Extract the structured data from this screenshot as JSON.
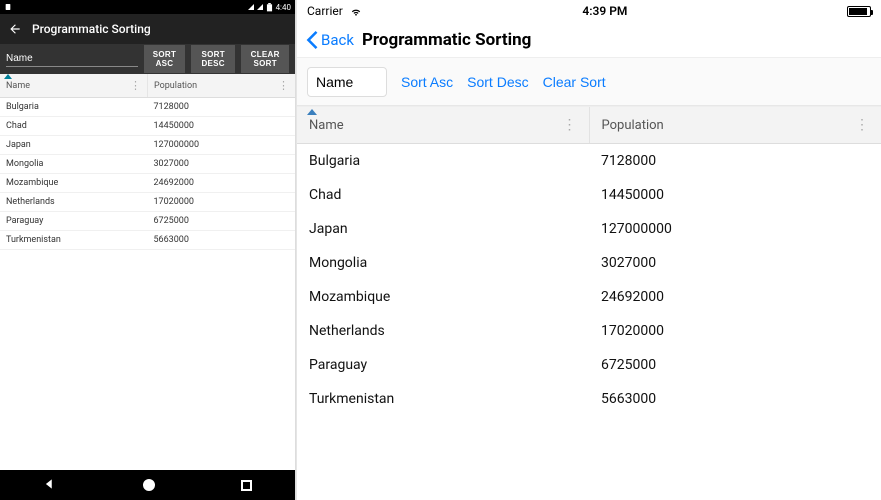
{
  "android": {
    "status_time": "4:40",
    "appbar_title": "Programmatic Sorting",
    "field_value": "Name",
    "buttons": {
      "sort_asc": "SORT ASC",
      "sort_desc": "SORT DESC",
      "clear_sort": "CLEAR SORT"
    },
    "columns": {
      "name": "Name",
      "population": "Population"
    }
  },
  "ios": {
    "status_carrier": "Carrier",
    "status_time": "4:39 PM",
    "nav_back": "Back",
    "nav_title": "Programmatic Sorting",
    "field_value": "Name",
    "buttons": {
      "sort_asc": "Sort Asc",
      "sort_desc": "Sort Desc",
      "clear_sort": "Clear Sort"
    },
    "columns": {
      "name": "Name",
      "population": "Population"
    }
  },
  "rows": [
    {
      "name": "Bulgaria",
      "population": "7128000"
    },
    {
      "name": "Chad",
      "population": "14450000"
    },
    {
      "name": "Japan",
      "population": "127000000"
    },
    {
      "name": "Mongolia",
      "population": "3027000"
    },
    {
      "name": "Mozambique",
      "population": "24692000"
    },
    {
      "name": "Netherlands",
      "population": "17020000"
    },
    {
      "name": "Paraguay",
      "population": "6725000"
    },
    {
      "name": "Turkmenistan",
      "population": "5663000"
    }
  ]
}
